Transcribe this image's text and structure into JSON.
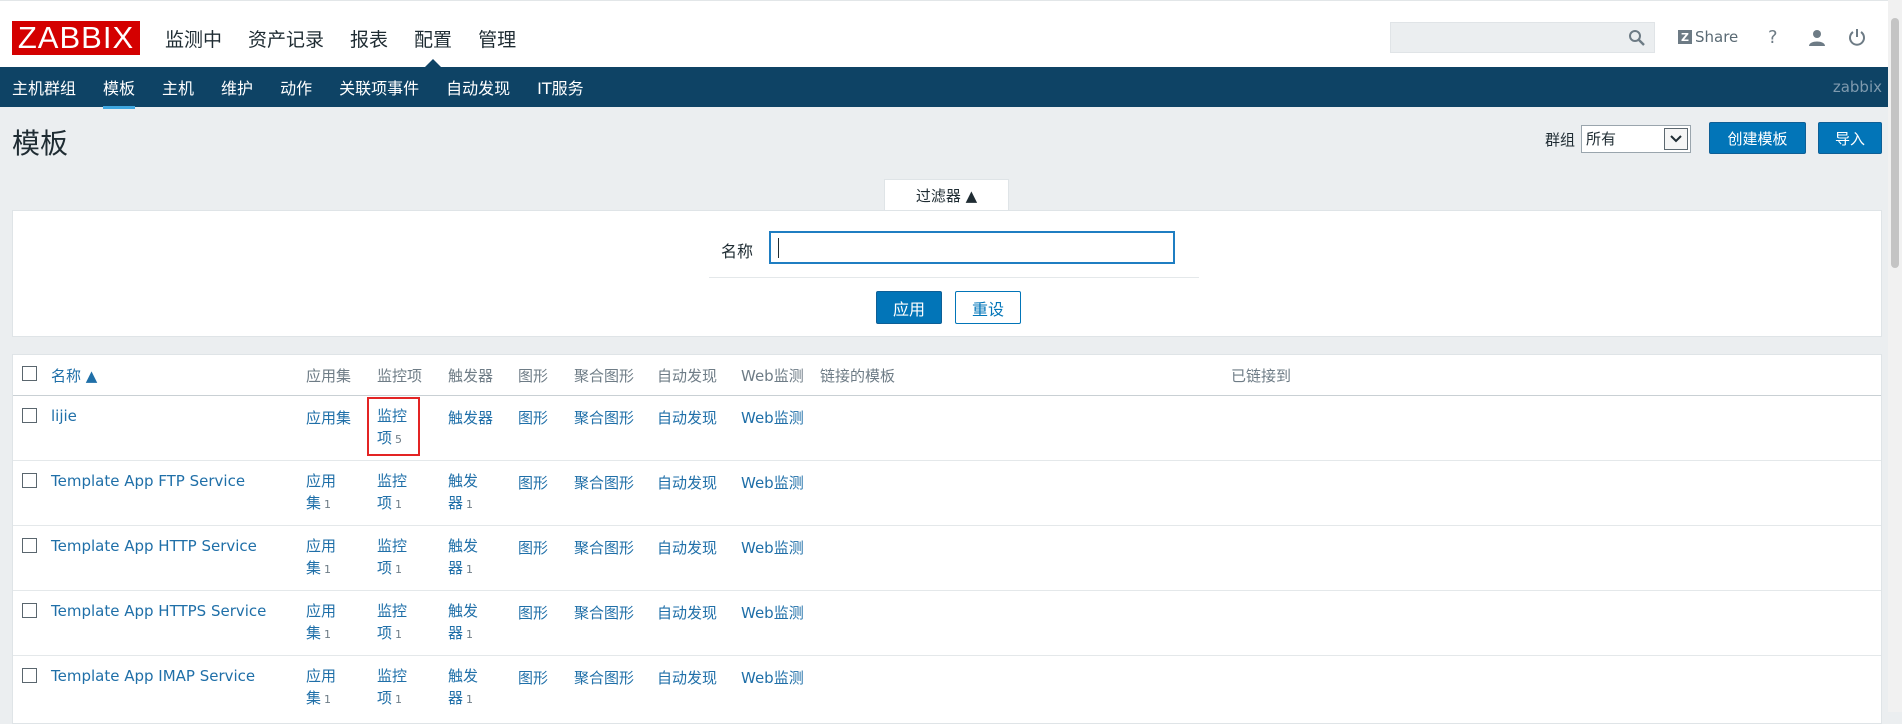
{
  "logo": "ZABBIX",
  "main_nav": [
    "监测中",
    "资产记录",
    "报表",
    "配置",
    "管理"
  ],
  "main_nav_active": "配置",
  "header": {
    "search_placeholder": "",
    "share_label": "Share",
    "help": "?"
  },
  "sub_nav": [
    "主机群组",
    "模板",
    "主机",
    "维护",
    "动作",
    "关联项事件",
    "自动发现",
    "IT服务"
  ],
  "sub_nav_active": "模板",
  "user": "zabbix",
  "page": {
    "title": "模板",
    "group_label": "群组",
    "group_value": "所有",
    "create_button": "创建模板",
    "import_button": "导入"
  },
  "filter": {
    "tab_label": "过滤器 ▲",
    "name_label": "名称",
    "name_value": "",
    "apply": "应用",
    "reset": "重设"
  },
  "table": {
    "columns": [
      "名称 ▲",
      "应用集",
      "监控项",
      "触发器",
      "图形",
      "聚合图形",
      "自动发现",
      "Web监测",
      "链接的模板",
      "已链接到"
    ],
    "rows": [
      {
        "name": "lijie",
        "apps": "应用集",
        "apps_count": "",
        "items": "监控项",
        "items_count": "5",
        "triggers": "触发器",
        "triggers_count": "",
        "graphs": "图形",
        "screens": "聚合图形",
        "discovery": "自动发现",
        "web": "Web监测"
      },
      {
        "name": "Template App FTP Service",
        "apps": "应用集",
        "apps_count": "1",
        "items": "监控项",
        "items_count": "1",
        "triggers": "触发器",
        "triggers_count": "1",
        "graphs": "图形",
        "screens": "聚合图形",
        "discovery": "自动发现",
        "web": "Web监测"
      },
      {
        "name": "Template App HTTP Service",
        "apps": "应用集",
        "apps_count": "1",
        "items": "监控项",
        "items_count": "1",
        "triggers": "触发器",
        "triggers_count": "1",
        "graphs": "图形",
        "screens": "聚合图形",
        "discovery": "自动发现",
        "web": "Web监测"
      },
      {
        "name": "Template App HTTPS Service",
        "apps": "应用集",
        "apps_count": "1",
        "items": "监控项",
        "items_count": "1",
        "triggers": "触发器",
        "triggers_count": "1",
        "graphs": "图形",
        "screens": "聚合图形",
        "discovery": "自动发现",
        "web": "Web监测"
      },
      {
        "name": "Template App IMAP Service",
        "apps": "应用集",
        "apps_count": "1",
        "items": "监控项",
        "items_count": "1",
        "triggers": "触发器",
        "triggers_count": "1",
        "graphs": "图形",
        "screens": "聚合图形",
        "discovery": "自动发现",
        "web": "Web监测"
      }
    ]
  }
}
